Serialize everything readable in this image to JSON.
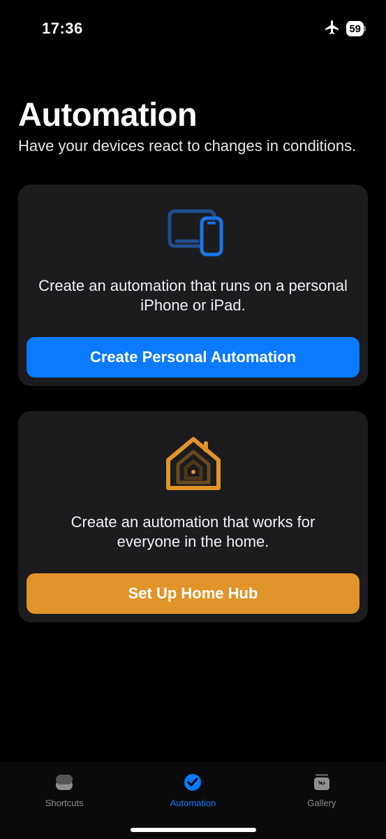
{
  "status": {
    "time": "17:36",
    "battery": "59"
  },
  "header": {
    "title": "Automation",
    "subtitle": "Have your devices react to changes in conditions."
  },
  "cards": {
    "personal": {
      "text": "Create an automation that runs on a personal iPhone or iPad.",
      "button": "Create Personal Automation"
    },
    "home": {
      "text": "Create an automation that works for everyone in the home.",
      "button": "Set Up Home Hub"
    }
  },
  "tabs": {
    "shortcuts": "Shortcuts",
    "automation": "Automation",
    "gallery": "Gallery"
  }
}
